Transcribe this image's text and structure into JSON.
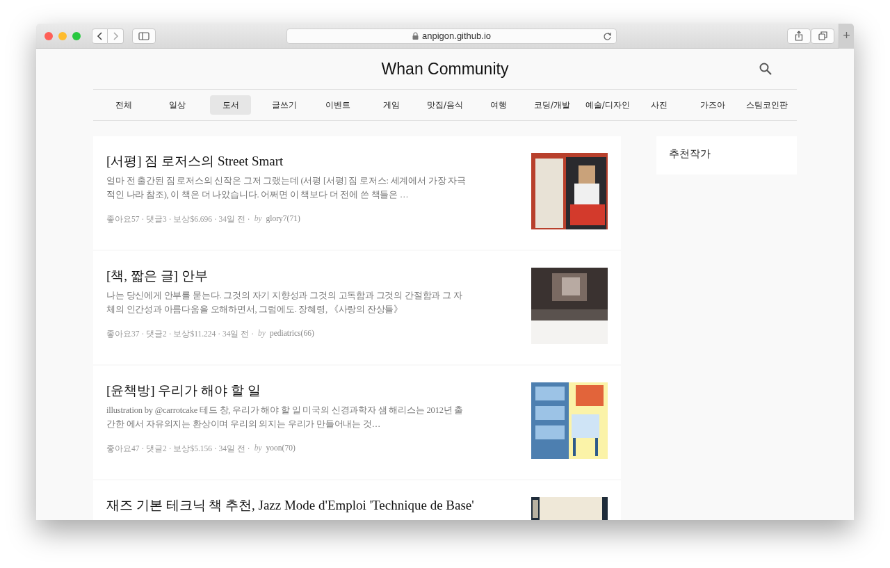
{
  "browser": {
    "url": "anpigon.github.io",
    "new_tab": "+"
  },
  "site": {
    "title": "Whan Community"
  },
  "tabs": [
    {
      "label": "전체",
      "selected": false
    },
    {
      "label": "일상",
      "selected": false
    },
    {
      "label": "도서",
      "selected": true
    },
    {
      "label": "글쓰기",
      "selected": false
    },
    {
      "label": "이벤트",
      "selected": false
    },
    {
      "label": "게임",
      "selected": false
    },
    {
      "label": "맛집/음식",
      "selected": false
    },
    {
      "label": "여행",
      "selected": false
    },
    {
      "label": "코딩/개발",
      "selected": false
    },
    {
      "label": "예술/디자인",
      "selected": false
    },
    {
      "label": "사진",
      "selected": false
    },
    {
      "label": "가즈아",
      "selected": false
    },
    {
      "label": "스팀코인판",
      "selected": false
    }
  ],
  "posts": [
    {
      "title": "[서평] 짐 로저스의 Street Smart",
      "excerpt": "얼마 전 출간된 짐 로저스의 신작은 그저 그랬는데 (서평 [서평] 짐 로저스: 세계에서 가장 자극적인 나라 참조), 이 책은 더 나았습니다. 어쩌면 이 책보다 더 전에 쓴 책들은 …",
      "meta": "좋아요57 · 댓글3 · 보상$6.696 · 34일 전 ·",
      "by": "by",
      "author": "glory7(71)"
    },
    {
      "title": "[책, 짧은 글] 안부",
      "excerpt": "나는 당신에게 안부를 묻는다. 그것의 자기 지향성과 그것의 고독함과 그것의 간절함과 그 자체의 인간성과 아름다움을 오해하면서, 그럼에도. 장혜령, 《사랑의 잔상들》",
      "meta": "좋아요37 · 댓글2 · 보상$11.224 · 34일 전 ·",
      "by": "by",
      "author": "pediatrics(66)"
    },
    {
      "title": "[윤책방] 우리가 해야 할 일",
      "excerpt": "illustration by @carrotcake 테드 창, 우리가 해야 할 일 미국의 신경과학자 샘 해리스는 2012년 출간한 에서 자유의지는 환상이며 우리의 의지는 우리가 만들어내는 것…",
      "meta": "좋아요47 · 댓글2 · 보상$5.156 · 34일 전 ·",
      "by": "by",
      "author": "yoon(70)"
    },
    {
      "title": "재즈 기본 테크닉 책 추천, Jazz Mode d'Emploi 'Technique de Base'"
    }
  ],
  "sidebar": {
    "title": "추천작가"
  }
}
